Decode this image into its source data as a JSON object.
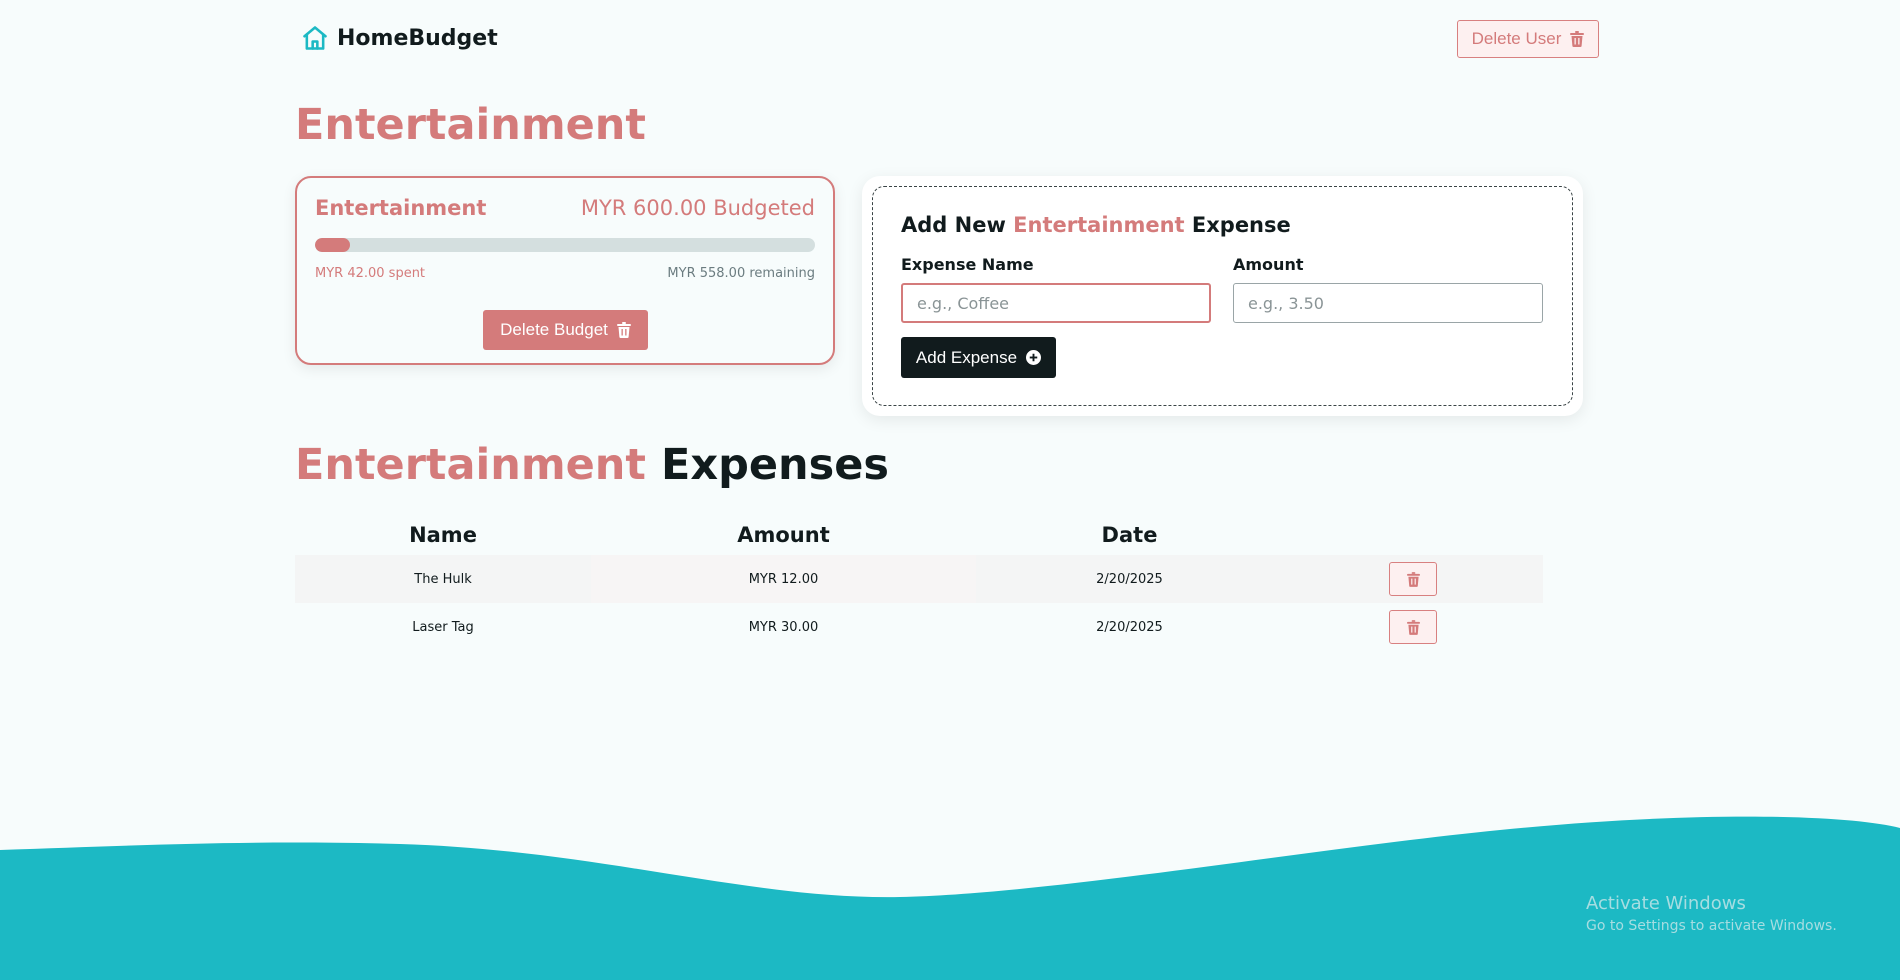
{
  "brand": {
    "name": "HomeBudget"
  },
  "header": {
    "delete_user_label": "Delete User"
  },
  "page": {
    "title": "Entertainment"
  },
  "budget_card": {
    "name": "Entertainment",
    "budget_text": "MYR 600.00 Budgeted",
    "spent_text": "MYR 42.00 spent",
    "remaining_text": "MYR 558.00 remaining",
    "progress_fraction": 0.07,
    "delete_label": "Delete Budget"
  },
  "expense_form": {
    "title_prefix": "Add New",
    "title_category": "Entertainment",
    "title_suffix": "Expense",
    "name_label": "Expense Name",
    "name_placeholder": "e.g., Coffee",
    "name_value": "",
    "amount_label": "Amount",
    "amount_placeholder": "e.g., 3.50",
    "amount_value": "",
    "submit_label": "Add Expense"
  },
  "expenses": {
    "title_category": "Entertainment",
    "title_suffix": "Expenses",
    "columns": [
      "Name",
      "Amount",
      "Date"
    ],
    "rows": [
      {
        "name": "The Hulk",
        "amount": "MYR 12.00",
        "date": "2/20/2025"
      },
      {
        "name": "Laser Tag",
        "amount": "MYR 30.00",
        "date": "2/20/2025"
      }
    ]
  },
  "watermark": {
    "title": "Activate Windows",
    "subtitle": "Go to Settings to activate Windows."
  },
  "colors": {
    "accent": "#d47b7b",
    "brand_teal": "#1cb9c4",
    "dark": "#111b1d",
    "background": "#f7fcfc"
  },
  "icons": {
    "logo": "home-icon",
    "delete": "trash-icon",
    "add": "plus-circle-icon"
  }
}
